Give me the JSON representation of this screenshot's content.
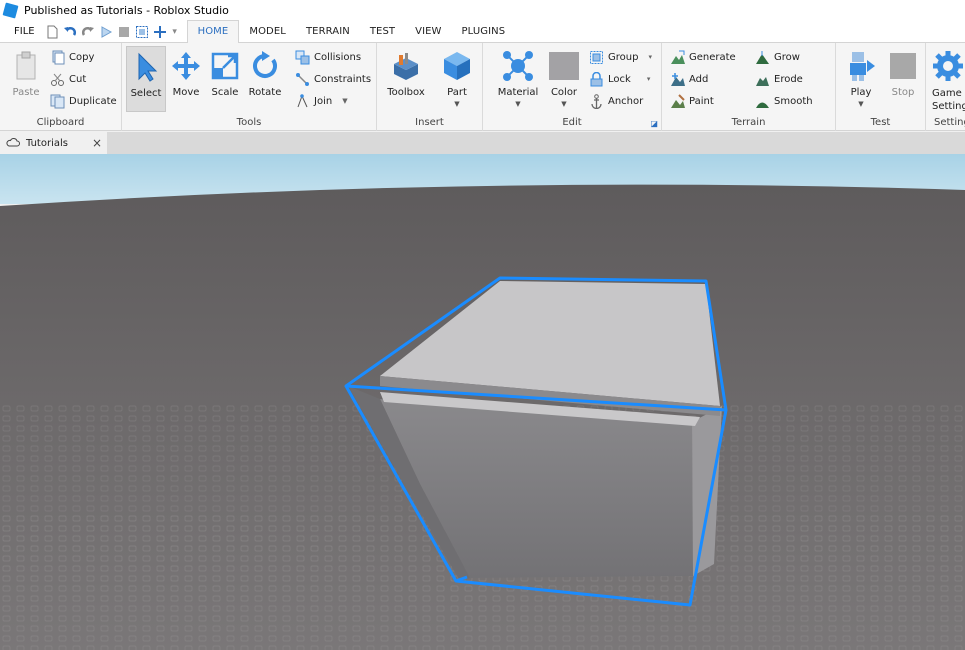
{
  "window": {
    "title": "Published as Tutorials - Roblox Studio"
  },
  "menu": {
    "file": "FILE",
    "tabs": [
      "HOME",
      "MODEL",
      "TERRAIN",
      "TEST",
      "VIEW",
      "PLUGINS"
    ],
    "active_tab": "HOME"
  },
  "ribbon": {
    "clipboard": {
      "label": "Clipboard",
      "paste": "Paste",
      "copy": "Copy",
      "cut": "Cut",
      "duplicate": "Duplicate"
    },
    "tools": {
      "label": "Tools",
      "select": "Select",
      "move": "Move",
      "scale": "Scale",
      "rotate": "Rotate",
      "collisions": "Collisions",
      "constraints": "Constraints",
      "join": "Join"
    },
    "insert": {
      "label": "Insert",
      "toolbox": "Toolbox",
      "part": "Part"
    },
    "edit": {
      "label": "Edit",
      "material": "Material",
      "color": "Color",
      "group": "Group",
      "lock": "Lock",
      "anchor": "Anchor"
    },
    "terrain": {
      "label": "Terrain",
      "generate": "Generate",
      "add": "Add",
      "paint": "Paint",
      "grow": "Grow",
      "erode": "Erode",
      "smooth": "Smooth"
    },
    "test": {
      "label": "Test",
      "play": "Play",
      "stop": "Stop"
    },
    "settings": {
      "label": "Settings",
      "game_settings": "Game Settings"
    }
  },
  "document_tabs": [
    {
      "label": "Tutorials"
    }
  ],
  "colors": {
    "accent": "#2b6fc0",
    "selection": "#1a8cff",
    "sky": "#b8dbec",
    "baseplate": "#6b6869",
    "part": "#a3a2a5"
  }
}
